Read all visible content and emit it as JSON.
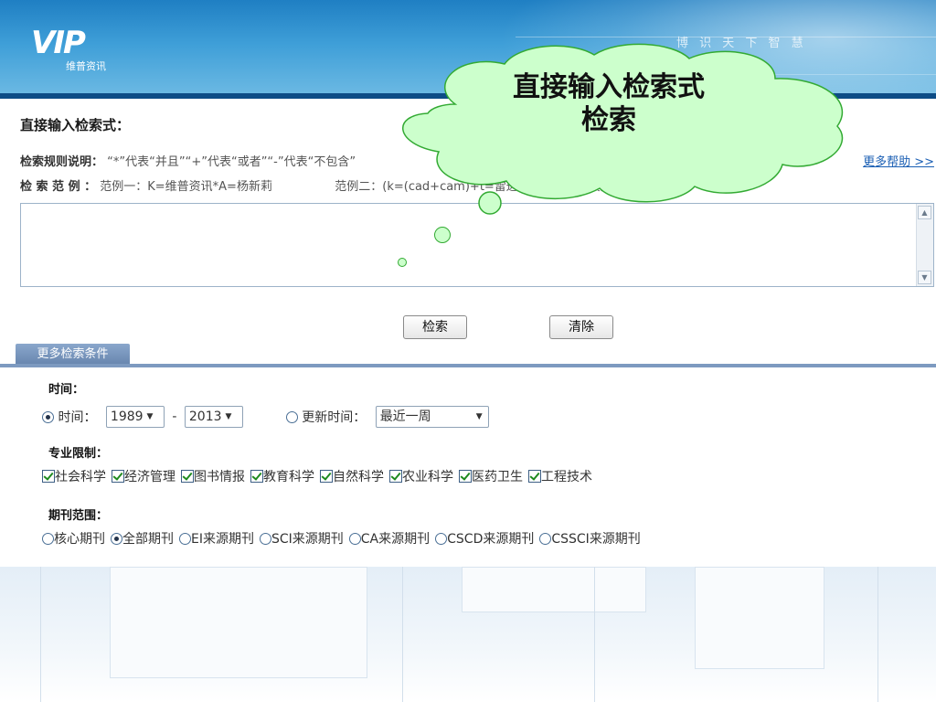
{
  "header": {
    "logo_letters": "VIP",
    "logo_sub": "维普资讯",
    "slogan": "博 识 天 下 智 慧"
  },
  "search": {
    "title": "直接输入检索式：",
    "rules_label": "检索规则说明：",
    "rules_text": "“*”代表“并且”“+”代表“或者”“-”代表“不包含”",
    "more_help": "更多帮助 >>",
    "examples_label": "检 索 范 例 ：",
    "example1": "范例一：K=维普资讯*A=杨新莉",
    "example2": "范例二：(k=(cad+cam)+t=雷达)*r=机械-k=模具",
    "textarea_value": "",
    "search_button": "检索",
    "clear_button": "清除"
  },
  "more_conditions": {
    "tab_label": "更多检索条件",
    "time": {
      "title": "时间：",
      "time_label": "时间：",
      "from_year": "1989",
      "dash": "-",
      "to_year": "2013",
      "update_label": "更新时间：",
      "update_value": "最近一周",
      "selected": "time"
    },
    "subject": {
      "title": "专业限制：",
      "items": [
        {
          "label": "社会科学",
          "checked": true
        },
        {
          "label": "经济管理",
          "checked": true
        },
        {
          "label": "图书情报",
          "checked": true
        },
        {
          "label": "教育科学",
          "checked": true
        },
        {
          "label": "自然科学",
          "checked": true
        },
        {
          "label": "农业科学",
          "checked": true
        },
        {
          "label": "医药卫生",
          "checked": true
        },
        {
          "label": "工程技术",
          "checked": true
        }
      ]
    },
    "journal": {
      "title": "期刊范围：",
      "items": [
        {
          "label": "核心期刊",
          "selected": false
        },
        {
          "label": "全部期刊",
          "selected": true
        },
        {
          "label": "EI来源期刊",
          "selected": false
        },
        {
          "label": "SCI来源期刊",
          "selected": false
        },
        {
          "label": "CA来源期刊",
          "selected": false
        },
        {
          "label": "CSCD来源期刊",
          "selected": false
        },
        {
          "label": "CSSCI来源期刊",
          "selected": false
        }
      ]
    }
  },
  "callout": {
    "line1": "直接输入检索式",
    "line2": "检索"
  },
  "colors": {
    "header_blue": "#3f9fd8",
    "tab_blue": "#6684ad",
    "cloud_fill": "#ccffcc",
    "cloud_stroke": "#33aa33",
    "link_blue": "#1b5fb4",
    "check_green": "#1e8a1e"
  }
}
